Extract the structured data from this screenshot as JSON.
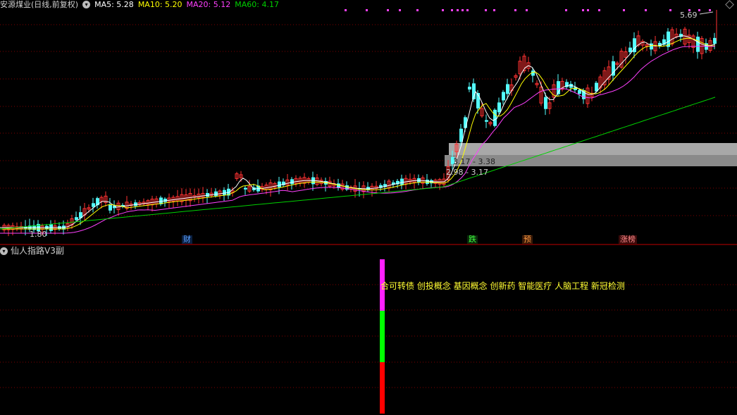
{
  "header": {
    "stock_name": "安源煤业(日线,前复权)",
    "ma5": "MA5: 5.28",
    "ma10": "MA10: 5.20",
    "ma20": "MA20: 5.12",
    "ma60": "MA60: 4.17"
  },
  "colors": {
    "background": "#000000",
    "up_candle": "#ff3232",
    "down_candle": "#54ffff",
    "ma5": "#ffffff",
    "ma10": "#ffff00",
    "ma20": "#ff40ff",
    "ma60": "#00d000",
    "grid": "#800000",
    "divider": "#b00000"
  },
  "price_labels": {
    "high": "5.69",
    "low": "1.80",
    "gap_upper": "3.17 - 3.38",
    "gap_lower": "2.98 - 3.17"
  },
  "events": {
    "cai": "财",
    "die": "跌",
    "yu": "预",
    "zhangbang": "涨榜"
  },
  "sub_panel": {
    "title": "仙人指路V3副",
    "concepts": "合可转债 创投概念 基因概念 创新药 智能医疗 人脑工程 新冠检测"
  },
  "icons": {
    "header_toggle": "chevron-down-icon",
    "ma_settings": "chevron-down-icon",
    "sub_toggle": "chevron-down-icon",
    "corner": "diamond-icon"
  }
}
